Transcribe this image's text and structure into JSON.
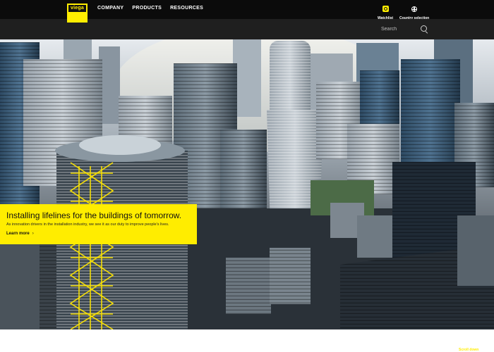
{
  "header": {
    "logo_text": "viega",
    "nav": [
      {
        "label": "COMPANY"
      },
      {
        "label": "PRODUCTS"
      },
      {
        "label": "RESOURCES"
      }
    ],
    "watchlist_label": "Watchlist",
    "country_label": "Country selection"
  },
  "search": {
    "placeholder": "Search"
  },
  "hero": {
    "title": "Installing lifelines for the buildings of tomorrow.",
    "subtitle": "As innovation drivers in the installation industry, we see it as our duty to improve people's lives.",
    "cta_label": "Learn more",
    "cta_chevron": "›"
  },
  "footer": {
    "scroll_label": "Scroll down"
  },
  "colors": {
    "brand_yellow": "#ffed00",
    "nav_bg": "#0b0b0b",
    "search_bg": "#1f1f1f"
  }
}
